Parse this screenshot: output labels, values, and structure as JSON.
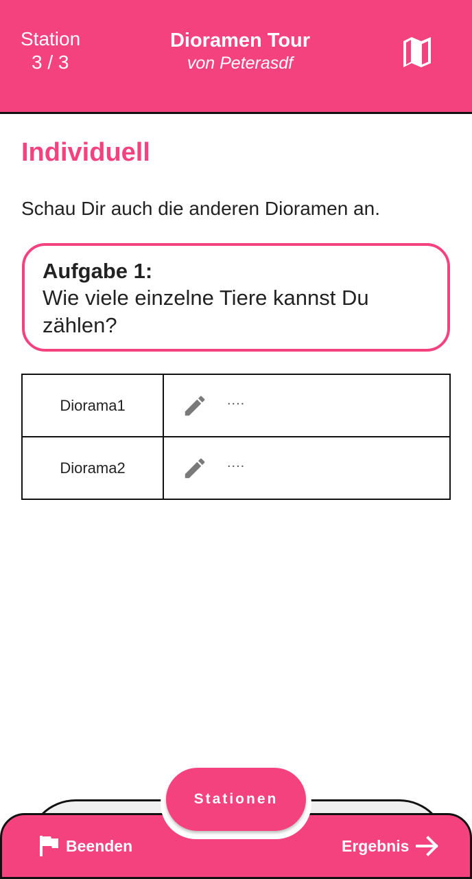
{
  "header": {
    "station_label": "Station",
    "station_count": "3 / 3",
    "tour_title": "Dioramen Tour",
    "tour_author": "von Peterasdf",
    "map_icon": "map-icon"
  },
  "content": {
    "heading": "Individuell",
    "intro": "Schau Dir auch die anderen Dioramen an.",
    "task_label": "Aufgabe 1:",
    "task_text": "Wie viele einzelne Tiere kannst Du zählen?"
  },
  "table": {
    "rows": [
      {
        "name": "Diorama1",
        "value": "....",
        "icon": "edit-icon"
      },
      {
        "name": "Diorama2",
        "value": "....",
        "icon": "edit-icon"
      }
    ]
  },
  "bottom": {
    "stations_label": "Stationen",
    "end_label": "Beenden",
    "result_label": "Ergebnis",
    "end_icon": "flag-icon",
    "result_icon": "arrow-right-icon"
  },
  "colors": {
    "accent": "#f4427e",
    "text": "#222222",
    "border": "#111111"
  }
}
